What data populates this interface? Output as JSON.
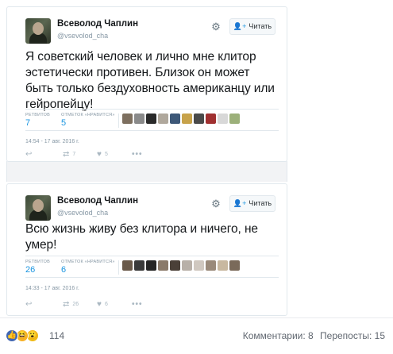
{
  "tweets": [
    {
      "author_name": "Всеволод Чаплин",
      "author_handle": "@vsevolod_cha",
      "follow_label": "Читать",
      "text": "Я советский человек и лично мне клитор эстетически противен. Близок он может быть только бездуховность американцу или гейропейцу!",
      "retweets_label": "РЕТВИТОВ",
      "retweets": "7",
      "likes_label": "ОТМЕТОК «НРАВИТСЯ»",
      "likes": "5",
      "timestamp": "14:54 - 17 авг. 2016 г.",
      "action_retweet_count": "7",
      "action_like_count": "5",
      "liker_avatar_colors": [
        "#7d6f5f",
        "#8a8a8a",
        "#2a2a2a",
        "#b0a89c",
        "#3d5878",
        "#c7a24a",
        "#4a4a4a",
        "#a03030",
        "#d8d8d8",
        "#9cb07a"
      ]
    },
    {
      "author_name": "Всеволод Чаплин",
      "author_handle": "@vsevolod_cha",
      "follow_label": "Читать",
      "text": "Всю жизнь живу без клитора и ничего, не умер!",
      "retweets_label": "РЕТВИТОВ",
      "retweets": "26",
      "likes_label": "ОТМЕТОК «НРАВИТСЯ»",
      "likes": "6",
      "timestamp": "14:33 - 17 авг. 2016 г.",
      "action_retweet_count": "26",
      "action_like_count": "6",
      "liker_avatar_colors": [
        "#6a5a4a",
        "#3a3a3a",
        "#252525",
        "#8a7a6a",
        "#4a4038",
        "#b8b0a8",
        "#d0c8c0",
        "#9a8a7a",
        "#c8b8a0",
        "#7a6a5a"
      ]
    }
  ],
  "icons": {
    "gear": "gear-icon",
    "follow": "add-user-icon",
    "reply": "reply-icon",
    "retweet": "retweet-icon",
    "like": "heart-icon",
    "more": "more-icon"
  },
  "facebook_bar": {
    "reaction_count": "114",
    "comments": "Комментарии: 8",
    "shares": "Перепосты: 15",
    "reactions": [
      "like",
      "haha",
      "wow"
    ]
  }
}
